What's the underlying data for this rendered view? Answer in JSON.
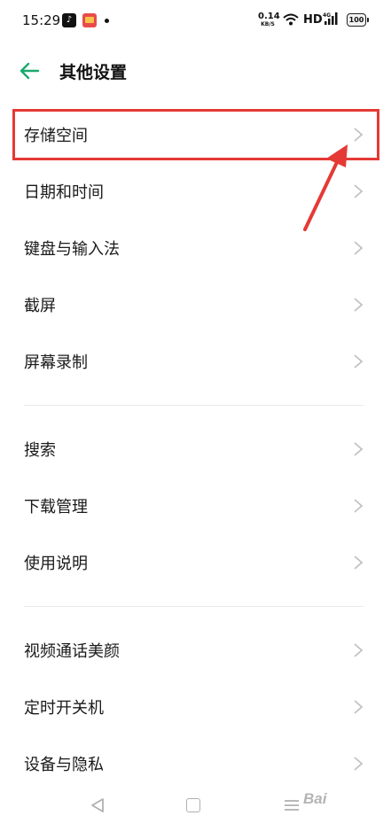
{
  "status_bar": {
    "time": "15:29",
    "net_speed_value": "0.14",
    "net_speed_unit": "KB/S",
    "network_type": "HD",
    "battery_level": "100",
    "app_icons": [
      "tiktok-icon",
      "notification-app-icon"
    ]
  },
  "header": {
    "title": "其他设置",
    "back_icon": "arrow-left-icon",
    "accent_color": "#1aaa6e"
  },
  "menu": {
    "groups": [
      [
        {
          "label": "存储空间",
          "highlighted": true
        },
        {
          "label": "日期和时间"
        },
        {
          "label": "键盘与输入法"
        },
        {
          "label": "截屏"
        },
        {
          "label": "屏幕录制"
        }
      ],
      [
        {
          "label": "搜索"
        },
        {
          "label": "下载管理"
        },
        {
          "label": "使用说明"
        }
      ],
      [
        {
          "label": "视频通话美颜"
        },
        {
          "label": "定时开关机"
        },
        {
          "label": "设备与隐私"
        }
      ]
    ]
  },
  "annotation": {
    "color": "#e53935"
  },
  "nav_bar": {
    "icons": [
      "nav-back-icon",
      "nav-home-icon",
      "nav-menu-icon"
    ]
  }
}
